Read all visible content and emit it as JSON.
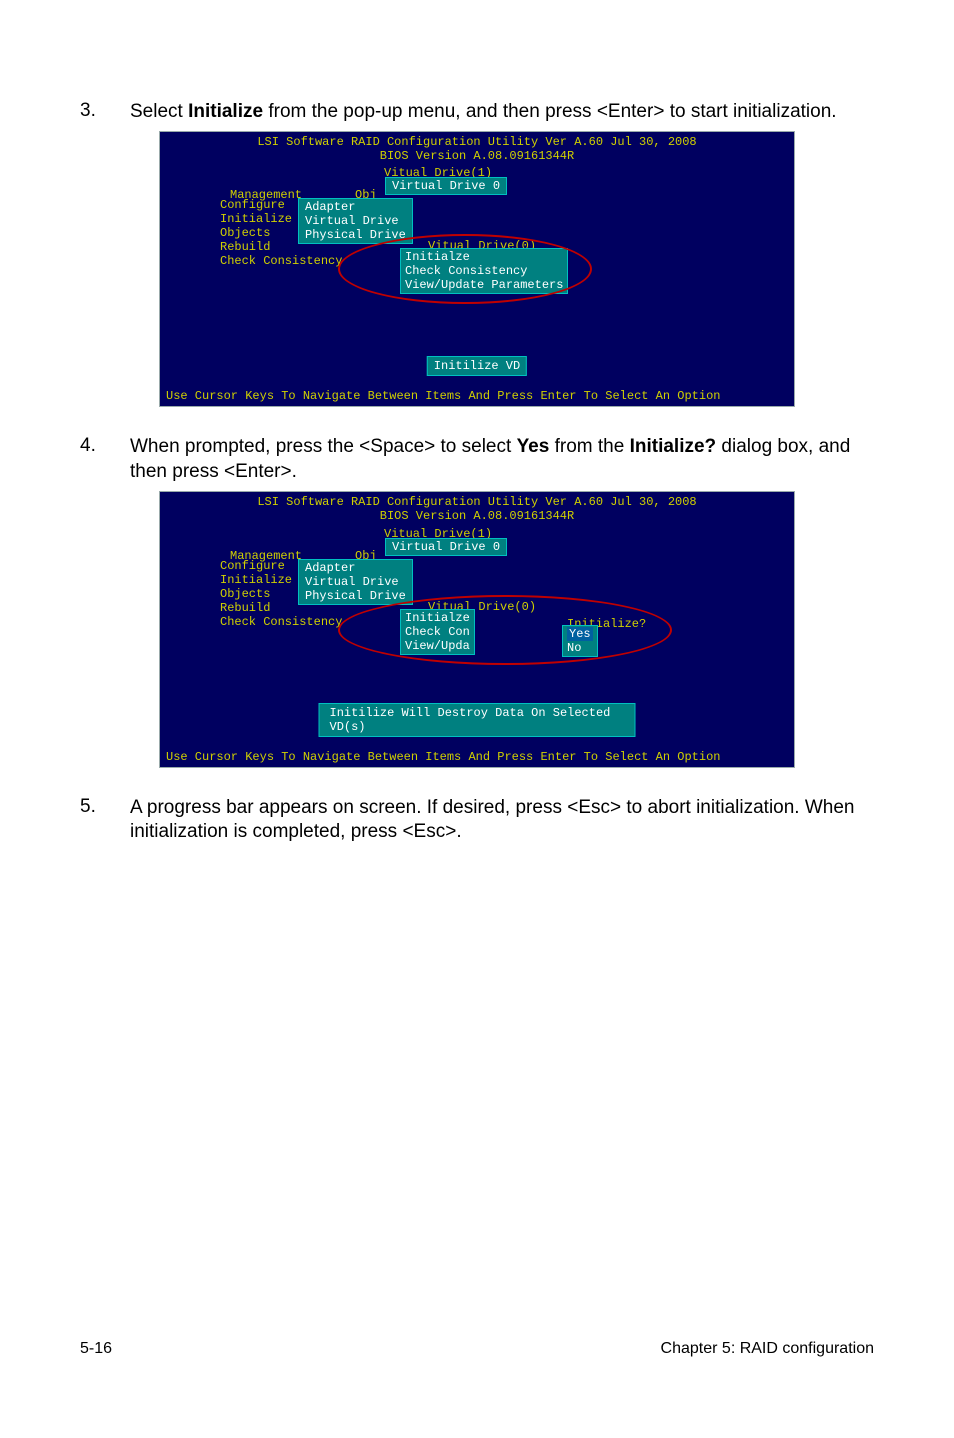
{
  "steps": {
    "s3": {
      "num": "3.",
      "text_a": "Select ",
      "bold_a": "Initialize",
      "text_b": " from the pop-up menu, and then press <Enter> to start initialization."
    },
    "s4": {
      "num": "4.",
      "text_a": "When prompted, press the <Space> to select ",
      "bold_a": "Yes",
      "text_b": " from the ",
      "bold_b": "Initialize?",
      "text_c": " dialog box, and then press <Enter>."
    },
    "s5": {
      "num": "5.",
      "text_a": "A progress bar appears on screen. If desired, press <Esc> to abort initialization. When initialization is completed, press <Esc>."
    }
  },
  "bios": {
    "header1": "LSI Software RAID Configuration Utility Ver A.60 Jul 30, 2008",
    "header2": "BIOS Version  A.08.09161344R",
    "vd_label": "Vitual Drive(1)",
    "vd0": "Virtual Drive 0",
    "obj_label": "Obj",
    "mgmt_label": "Management",
    "menu": {
      "configure": "Configure",
      "initialize": "Initialize",
      "objects": "Objects",
      "rebuild": "Rebuild",
      "check": "Check Consistency"
    },
    "obj_menu": {
      "adapter": "Adapter",
      "vd": "Virtual Drive",
      "pd": "Physical Drive"
    },
    "popup_label": "Vitual Drive(0)",
    "popup1": {
      "init": "Initialze",
      "check": "Check Consistency",
      "view": "View/Update Parameters"
    },
    "popup2": {
      "init": "Initialze",
      "check": "Check Con",
      "view": "View/Upda"
    },
    "init_prompt_label": "Initialize?",
    "yes": "Yes",
    "no": "No",
    "initilize_bar1": "Initilize VD",
    "initilize_bar2": "Initilize Will Destroy Data On Selected VD(s)",
    "footer": "Use Cursor Keys To Navigate Between Items And Press Enter To Select An Option"
  },
  "footer": {
    "left": "5-16",
    "right": "Chapter 5: RAID configuration"
  }
}
